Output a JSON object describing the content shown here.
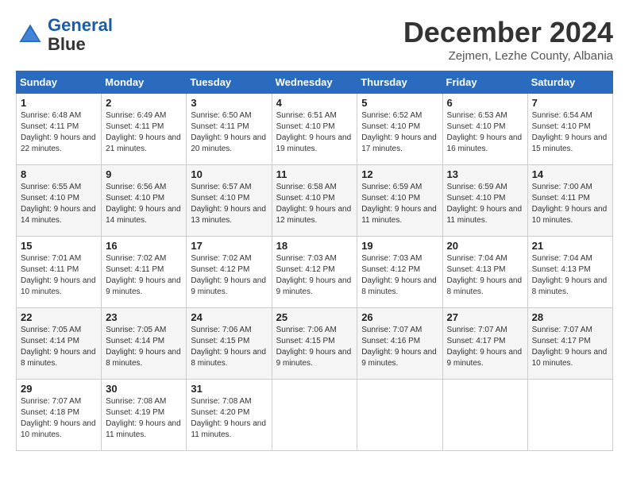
{
  "header": {
    "logo_line1": "General",
    "logo_line2": "Blue",
    "month_title": "December 2024",
    "location": "Zejmen, Lezhe County, Albania"
  },
  "weekdays": [
    "Sunday",
    "Monday",
    "Tuesday",
    "Wednesday",
    "Thursday",
    "Friday",
    "Saturday"
  ],
  "weeks": [
    [
      {
        "day": "1",
        "sunrise": "6:48 AM",
        "sunset": "4:11 PM",
        "daylight": "9 hours and 22 minutes."
      },
      {
        "day": "2",
        "sunrise": "6:49 AM",
        "sunset": "4:11 PM",
        "daylight": "9 hours and 21 minutes."
      },
      {
        "day": "3",
        "sunrise": "6:50 AM",
        "sunset": "4:11 PM",
        "daylight": "9 hours and 20 minutes."
      },
      {
        "day": "4",
        "sunrise": "6:51 AM",
        "sunset": "4:10 PM",
        "daylight": "9 hours and 19 minutes."
      },
      {
        "day": "5",
        "sunrise": "6:52 AM",
        "sunset": "4:10 PM",
        "daylight": "9 hours and 17 minutes."
      },
      {
        "day": "6",
        "sunrise": "6:53 AM",
        "sunset": "4:10 PM",
        "daylight": "9 hours and 16 minutes."
      },
      {
        "day": "7",
        "sunrise": "6:54 AM",
        "sunset": "4:10 PM",
        "daylight": "9 hours and 15 minutes."
      }
    ],
    [
      {
        "day": "8",
        "sunrise": "6:55 AM",
        "sunset": "4:10 PM",
        "daylight": "9 hours and 14 minutes."
      },
      {
        "day": "9",
        "sunrise": "6:56 AM",
        "sunset": "4:10 PM",
        "daylight": "9 hours and 14 minutes."
      },
      {
        "day": "10",
        "sunrise": "6:57 AM",
        "sunset": "4:10 PM",
        "daylight": "9 hours and 13 minutes."
      },
      {
        "day": "11",
        "sunrise": "6:58 AM",
        "sunset": "4:10 PM",
        "daylight": "9 hours and 12 minutes."
      },
      {
        "day": "12",
        "sunrise": "6:59 AM",
        "sunset": "4:10 PM",
        "daylight": "9 hours and 11 minutes."
      },
      {
        "day": "13",
        "sunrise": "6:59 AM",
        "sunset": "4:10 PM",
        "daylight": "9 hours and 11 minutes."
      },
      {
        "day": "14",
        "sunrise": "7:00 AM",
        "sunset": "4:11 PM",
        "daylight": "9 hours and 10 minutes."
      }
    ],
    [
      {
        "day": "15",
        "sunrise": "7:01 AM",
        "sunset": "4:11 PM",
        "daylight": "9 hours and 10 minutes."
      },
      {
        "day": "16",
        "sunrise": "7:02 AM",
        "sunset": "4:11 PM",
        "daylight": "9 hours and 9 minutes."
      },
      {
        "day": "17",
        "sunrise": "7:02 AM",
        "sunset": "4:12 PM",
        "daylight": "9 hours and 9 minutes."
      },
      {
        "day": "18",
        "sunrise": "7:03 AM",
        "sunset": "4:12 PM",
        "daylight": "9 hours and 9 minutes."
      },
      {
        "day": "19",
        "sunrise": "7:03 AM",
        "sunset": "4:12 PM",
        "daylight": "9 hours and 8 minutes."
      },
      {
        "day": "20",
        "sunrise": "7:04 AM",
        "sunset": "4:13 PM",
        "daylight": "9 hours and 8 minutes."
      },
      {
        "day": "21",
        "sunrise": "7:04 AM",
        "sunset": "4:13 PM",
        "daylight": "9 hours and 8 minutes."
      }
    ],
    [
      {
        "day": "22",
        "sunrise": "7:05 AM",
        "sunset": "4:14 PM",
        "daylight": "9 hours and 8 minutes."
      },
      {
        "day": "23",
        "sunrise": "7:05 AM",
        "sunset": "4:14 PM",
        "daylight": "9 hours and 8 minutes."
      },
      {
        "day": "24",
        "sunrise": "7:06 AM",
        "sunset": "4:15 PM",
        "daylight": "9 hours and 8 minutes."
      },
      {
        "day": "25",
        "sunrise": "7:06 AM",
        "sunset": "4:15 PM",
        "daylight": "9 hours and 9 minutes."
      },
      {
        "day": "26",
        "sunrise": "7:07 AM",
        "sunset": "4:16 PM",
        "daylight": "9 hours and 9 minutes."
      },
      {
        "day": "27",
        "sunrise": "7:07 AM",
        "sunset": "4:17 PM",
        "daylight": "9 hours and 9 minutes."
      },
      {
        "day": "28",
        "sunrise": "7:07 AM",
        "sunset": "4:17 PM",
        "daylight": "9 hours and 10 minutes."
      }
    ],
    [
      {
        "day": "29",
        "sunrise": "7:07 AM",
        "sunset": "4:18 PM",
        "daylight": "9 hours and 10 minutes."
      },
      {
        "day": "30",
        "sunrise": "7:08 AM",
        "sunset": "4:19 PM",
        "daylight": "9 hours and 11 minutes."
      },
      {
        "day": "31",
        "sunrise": "7:08 AM",
        "sunset": "4:20 PM",
        "daylight": "9 hours and 11 minutes."
      },
      null,
      null,
      null,
      null
    ]
  ]
}
